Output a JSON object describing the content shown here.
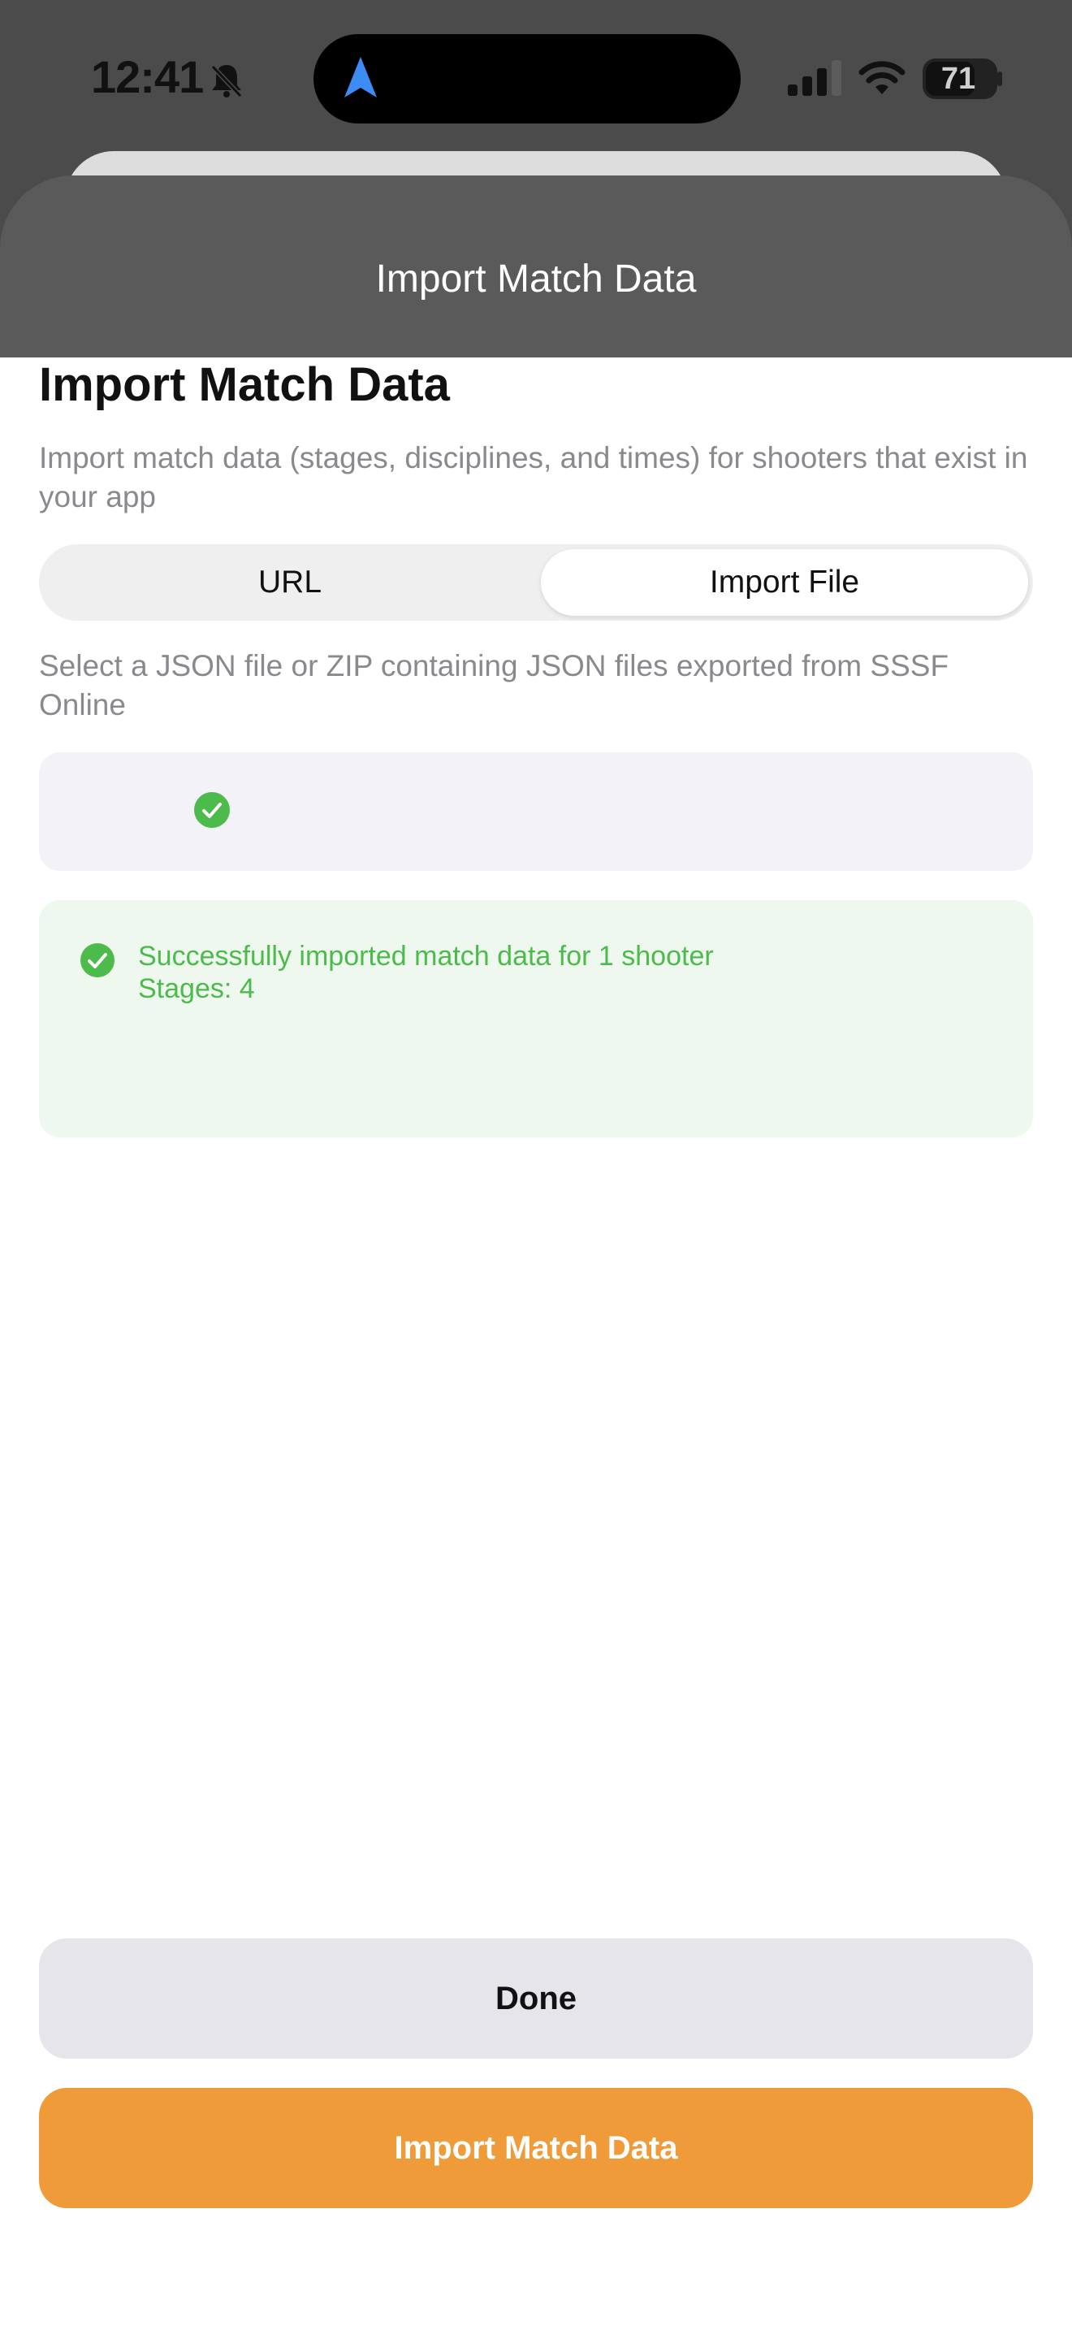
{
  "status_bar": {
    "time": "12:41",
    "battery": "71",
    "icons": [
      "bell-slash-icon",
      "location-arrow-icon",
      "cellular-signal-icon",
      "wifi-icon",
      "battery-icon"
    ]
  },
  "sheet": {
    "nav_title": "Import Match Data",
    "title": "Import Match Data",
    "subtitle": "Import match data (stages, disciplines, and times) for shooters that exist in your app"
  },
  "segmented": {
    "options": [
      {
        "label": "URL",
        "selected": false
      },
      {
        "label": "Import File",
        "selected": true
      }
    ]
  },
  "helper_text": "Select a JSON file or ZIP containing JSON files exported from SSSF Online",
  "file_card": {
    "file_name": "",
    "status_icon": "checkmark-circle-icon"
  },
  "result": {
    "message": "Successfully imported match data for 1 shooter",
    "stages": "Stages: 4",
    "status_icon": "checkmark-circle-icon"
  },
  "buttons": {
    "done": "Done",
    "import": "Import Match Data"
  },
  "colors": {
    "accent_orange": "#f09b3a",
    "success_green": "#4cbb4c",
    "success_bg": "#eef8ee",
    "secondary_text": "#8a8a8e",
    "location_blue": "#3d8cf5"
  }
}
